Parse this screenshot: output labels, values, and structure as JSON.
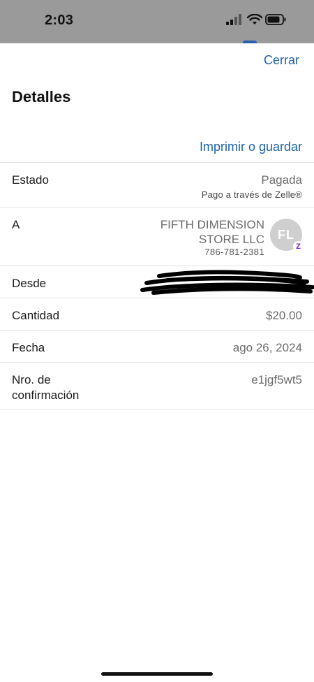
{
  "status_bar": {
    "time": "2:03",
    "icons": [
      "cellular-signal-icon",
      "wifi-icon",
      "battery-icon"
    ]
  },
  "header": {
    "close_label": "Cerrar",
    "title": "Detalles",
    "print_label": "Imprimir o guardar"
  },
  "details": {
    "status": {
      "label": "Estado",
      "value": "Pagada",
      "sub": "Pago a través de Zelle®"
    },
    "to": {
      "label": "A",
      "name_line1": "FIFTH DIMENSION",
      "name_line2": "STORE LLC",
      "phone": "786-781-2381",
      "avatar_initials": "FL",
      "badge": "Z"
    },
    "from": {
      "label": "Desde"
    },
    "amount": {
      "label": "Cantidad",
      "value": "$20.00"
    },
    "date": {
      "label": "Fecha",
      "value": "ago 26, 2024"
    },
    "confirmation": {
      "label_line1": "Nro. de",
      "label_line2": "confirmación",
      "value": "e1jgf5wt5"
    }
  },
  "colors": {
    "link": "#1f62a8",
    "zelle": "#6d1ed4",
    "status_bar": "#9a9a9a"
  }
}
